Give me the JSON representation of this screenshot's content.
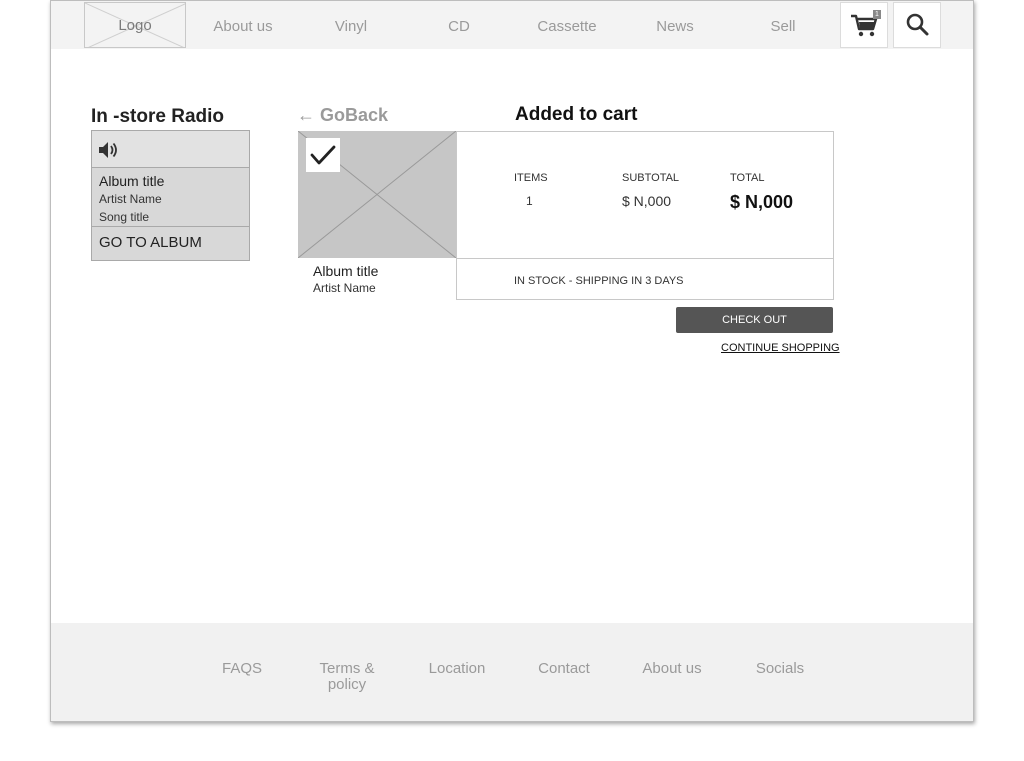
{
  "nav": {
    "logo": "Logo",
    "links": [
      "About us",
      "Vinyl",
      "CD",
      "Cassette",
      "News",
      "Sell"
    ],
    "cart_count": "1",
    "icons": {
      "cart": "cart-icon",
      "search": "search-icon"
    }
  },
  "radio": {
    "heading": "In -store Radio",
    "volume_icon": "speaker-icon",
    "album": "Album title",
    "artist": "Artist Name",
    "song": "Song title",
    "goto": "GO TO ALBUM"
  },
  "goback": "← GoBack",
  "cart": {
    "heading": "Added to cart",
    "album": "Album title",
    "artist": "Artist Name",
    "items_label": "ITEMS",
    "items_value": "1",
    "subtotal_label": "SUBTOTAL",
    "subtotal_value": "$ N,000",
    "total_label": "TOTAL",
    "total_value": "$ N,000",
    "stock": "IN STOCK - SHIPPING IN 3 DAYS",
    "checkout": "CHECK OUT",
    "continue": "CONTINUE SHOPPING"
  },
  "footer": {
    "links": [
      "FAQS",
      "Terms & policy",
      "Location",
      "Contact",
      "About us",
      "Socials"
    ]
  },
  "colors": {
    "nav_bg": "#f3f3f3",
    "button_bg": "#555555",
    "placeholder_gray": "#c6c6c6",
    "muted_text": "#9a9a9a"
  }
}
